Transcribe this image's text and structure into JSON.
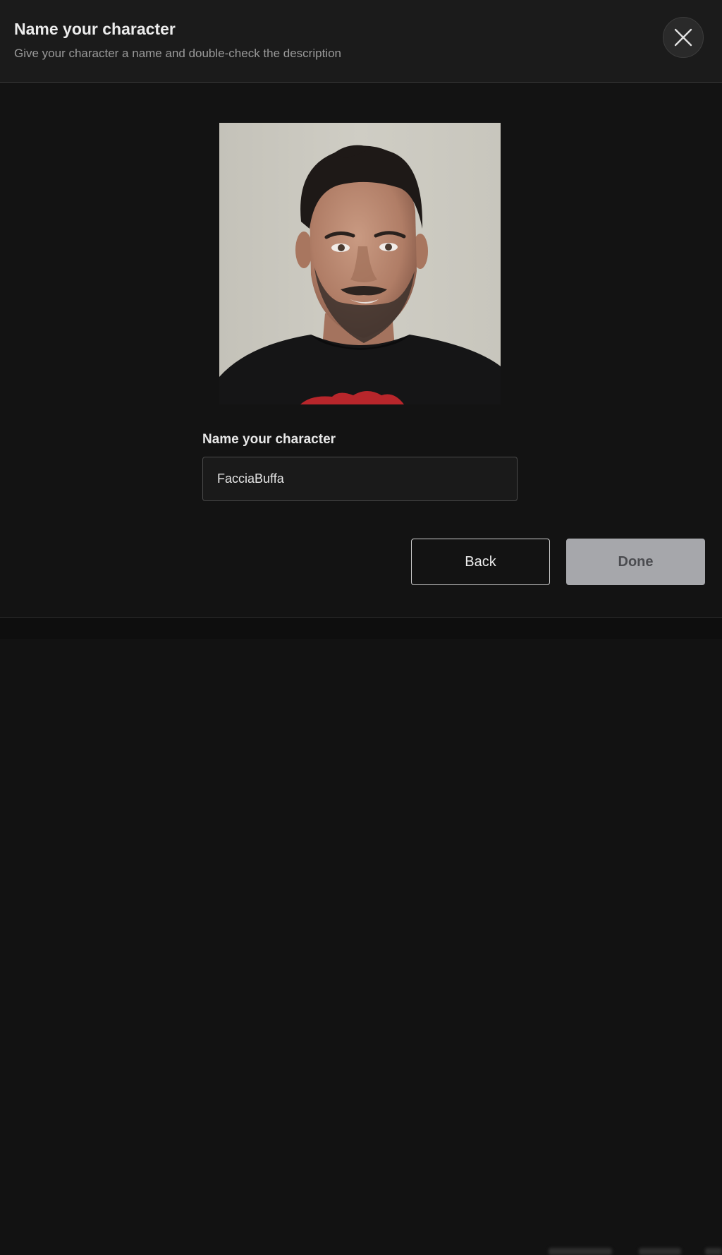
{
  "dialog": {
    "title": "Name your character",
    "subtitle": "Give your character a name and double-check the description",
    "close_icon": "close-icon"
  },
  "portrait": {
    "alt": "Character portrait photo"
  },
  "name_field": {
    "label": "Name your character",
    "value": "FacciaBuffa",
    "placeholder": ""
  },
  "actions": {
    "back_label": "Back",
    "done_label": "Done"
  },
  "colors": {
    "background": "#131313",
    "header_background": "#1b1b1b",
    "done_button": "#a6a7ab",
    "done_text": "#4b4c50",
    "back_border": "#cfcfcf"
  }
}
